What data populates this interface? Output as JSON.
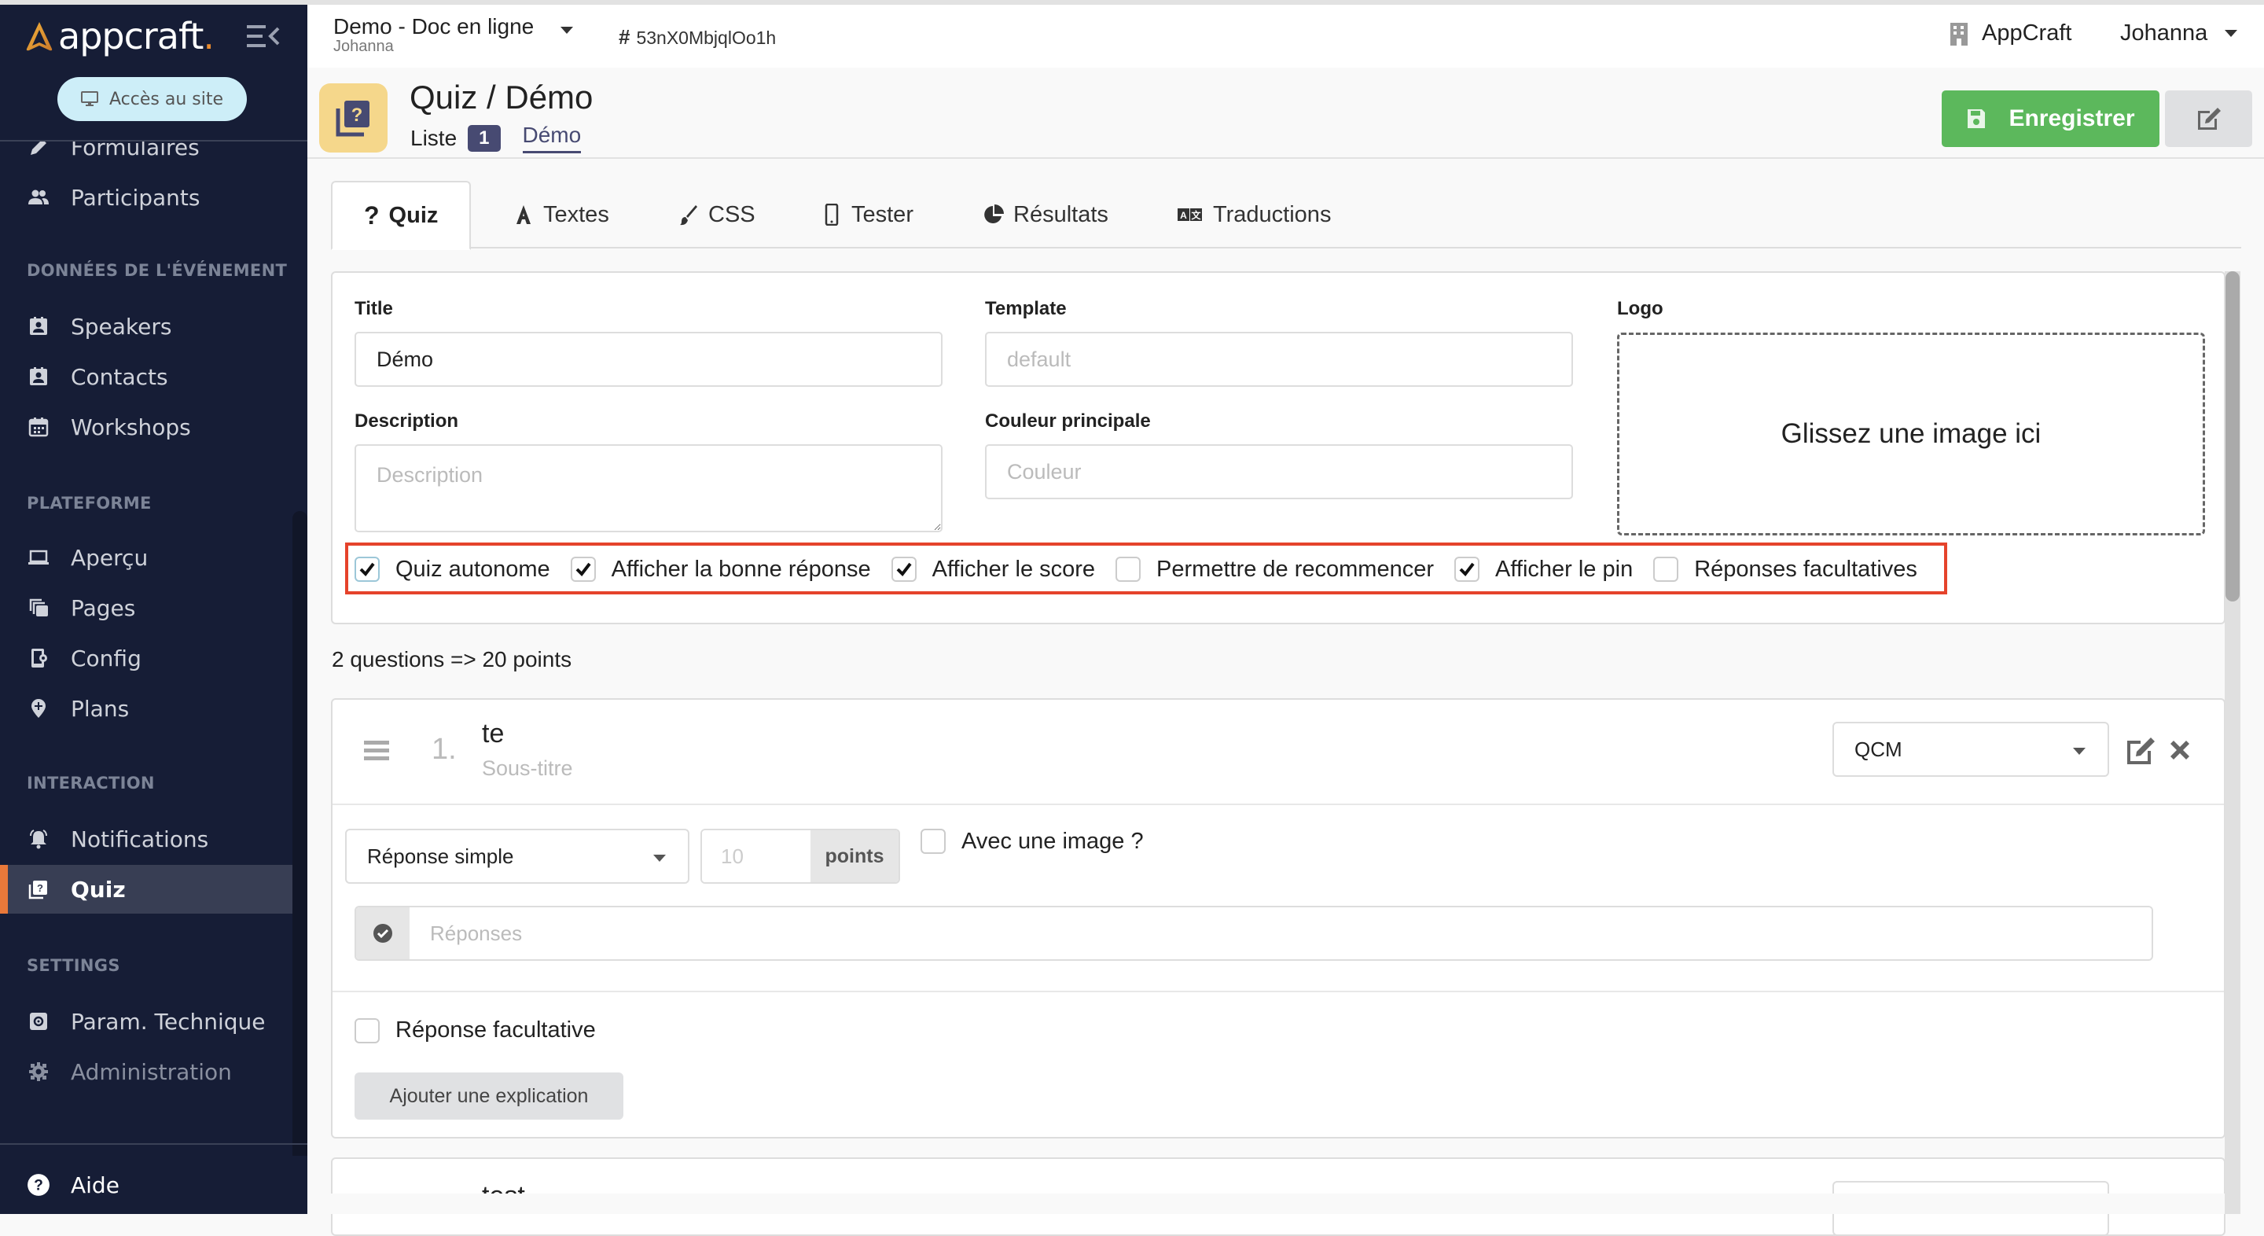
{
  "sidebar": {
    "logo_text": "appcraft",
    "logo_dot": ".",
    "site_button": "Accès au site",
    "items_top": [
      {
        "label": "Formulaires",
        "icon": "pencil-icon"
      },
      {
        "label": "Participants",
        "icon": "users-icon"
      }
    ],
    "sections": [
      {
        "title": "DONNÉES DE L'ÉVÉNEMENT",
        "items": [
          {
            "label": "Speakers",
            "icon": "id-badge-icon"
          },
          {
            "label": "Contacts",
            "icon": "id-badge-icon"
          },
          {
            "label": "Workshops",
            "icon": "calendar-icon"
          }
        ]
      },
      {
        "title": "PLATEFORME",
        "items": [
          {
            "label": "Aperçu",
            "icon": "laptop-icon"
          },
          {
            "label": "Pages",
            "icon": "copy-icon"
          },
          {
            "label": "Config",
            "icon": "device-settings-icon"
          },
          {
            "label": "Plans",
            "icon": "map-pin-icon"
          }
        ]
      },
      {
        "title": "INTERACTION",
        "items": [
          {
            "label": "Notifications",
            "icon": "bell-ring-icon"
          },
          {
            "label": "Quiz",
            "icon": "quiz-icon",
            "active": true
          }
        ]
      },
      {
        "title": "SETTINGS",
        "items": [
          {
            "label": "Param. Technique",
            "icon": "settings-box-icon"
          },
          {
            "label": "Administration",
            "icon": "gear-icon"
          }
        ]
      }
    ],
    "help": "Aide"
  },
  "topbar": {
    "project_name": "Demo - Doc en ligne",
    "project_user": "Johanna",
    "hash_symbol": "#",
    "project_id": "53nX0MbjqlOo1h",
    "org": "AppCraft",
    "user": "Johanna"
  },
  "page": {
    "title": "Quiz / Démo",
    "breadcrumb_list": "Liste",
    "breadcrumb_count": "1",
    "breadcrumb_current": "Démo",
    "save_label": "Enregistrer"
  },
  "tabs": [
    {
      "label": "Quiz",
      "icon": "question-icon",
      "active": true
    },
    {
      "label": "Textes",
      "icon": "font-icon"
    },
    {
      "label": "CSS",
      "icon": "paint-brush-icon"
    },
    {
      "label": "Tester",
      "icon": "mobile-icon"
    },
    {
      "label": "Résultats",
      "icon": "pie-chart-icon"
    },
    {
      "label": "Traductions",
      "icon": "translate-icon"
    }
  ],
  "form": {
    "title_label": "Title",
    "title_value": "Démo",
    "template_label": "Template",
    "template_placeholder": "default",
    "description_label": "Description",
    "description_placeholder": "Description",
    "color_label": "Couleur principale",
    "color_placeholder": "Couleur",
    "logo_label": "Logo",
    "logo_drop": "Glissez une image ici",
    "options": [
      {
        "label": "Quiz autonome",
        "checked": true
      },
      {
        "label": "Afficher la bonne réponse",
        "checked": true
      },
      {
        "label": "Afficher le score",
        "checked": true
      },
      {
        "label": "Permettre de recommencer",
        "checked": false
      },
      {
        "label": "Afficher le pin",
        "checked": true
      },
      {
        "label": "Réponses facultatives",
        "checked": false
      }
    ],
    "highlight_color": "#e5432b"
  },
  "summary": "2 questions => 20 points",
  "questions": [
    {
      "number": "1.",
      "title": "te",
      "subtitle_placeholder": "Sous-titre",
      "type": "QCM",
      "answer_mode": "Réponse simple",
      "points_placeholder": "10",
      "points_label": "points",
      "with_image_label": "Avec une image ?",
      "with_image": false,
      "answers_placeholder": "Réponses",
      "optional_label": "Réponse facultative",
      "optional": false,
      "explain_button": "Ajouter une explication"
    },
    {
      "title": "test"
    }
  ],
  "colors": {
    "sidebar_bg": "#161d36",
    "accent_orange": "#e9793a",
    "save_green": "#5cb85c",
    "brand_purple": "#474a72",
    "page_icon_bg": "#f5d78b"
  }
}
